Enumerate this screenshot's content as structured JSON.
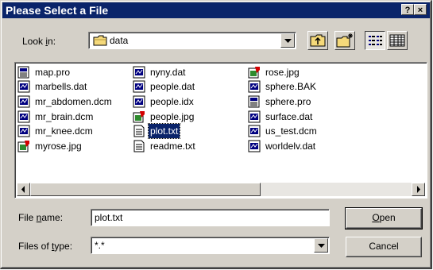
{
  "window": {
    "title": "Please Select a File",
    "help_label": "?",
    "close_label": "×"
  },
  "lookin": {
    "label_pre": "Look ",
    "label_accel": "i",
    "label_post": "n:",
    "value": "data"
  },
  "files": [
    {
      "name": "map.pro",
      "icon": "document-icon"
    },
    {
      "name": "marbells.dat",
      "icon": "dat-file-icon"
    },
    {
      "name": "mr_abdomen.dcm",
      "icon": "dat-file-icon"
    },
    {
      "name": "mr_brain.dcm",
      "icon": "dat-file-icon"
    },
    {
      "name": "mr_knee.dcm",
      "icon": "dat-file-icon"
    },
    {
      "name": "myrose.jpg",
      "icon": "image-icon"
    },
    {
      "name": "nyny.dat",
      "icon": "dat-file-icon"
    },
    {
      "name": "people.dat",
      "icon": "dat-file-icon"
    },
    {
      "name": "people.idx",
      "icon": "dat-file-icon"
    },
    {
      "name": "people.jpg",
      "icon": "image-icon"
    },
    {
      "name": "plot.txt",
      "icon": "text-file-icon",
      "selected": true
    },
    {
      "name": "readme.txt",
      "icon": "text-file-icon"
    },
    {
      "name": "rose.jpg",
      "icon": "image-icon"
    },
    {
      "name": "sphere.BAK",
      "icon": "dat-file-icon"
    },
    {
      "name": "sphere.pro",
      "icon": "document-icon"
    },
    {
      "name": "surface.dat",
      "icon": "dat-file-icon"
    },
    {
      "name": "us_test.dcm",
      "icon": "dat-file-icon"
    },
    {
      "name": "worldelv.dat",
      "icon": "dat-file-icon"
    }
  ],
  "filename": {
    "label_pre": "File ",
    "label_accel": "n",
    "label_post": "ame:",
    "value": "plot.txt"
  },
  "filetype": {
    "label_pre": "Files of ",
    "label_accel": "t",
    "label_post": "ype:",
    "value": "*.*"
  },
  "buttons": {
    "open_accel": "O",
    "open_rest": "pen",
    "cancel": "Cancel"
  },
  "colors": {
    "titlebar": "#0a246a",
    "face": "#d4d0c8",
    "selection": "#0a246a"
  }
}
